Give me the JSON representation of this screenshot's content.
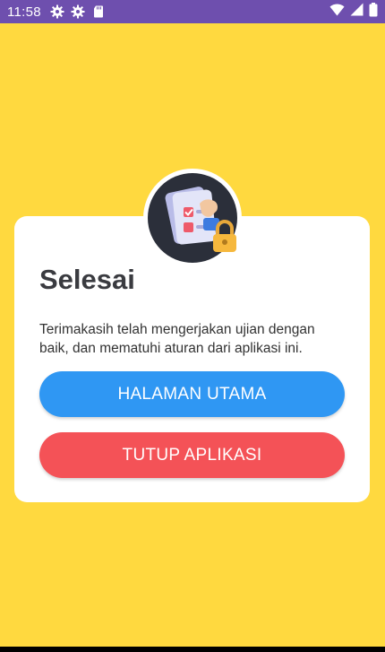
{
  "status_bar": {
    "time": "11:58",
    "left_icons": [
      "gear-icon",
      "gear-icon",
      "sd-card-icon"
    ],
    "right_icons": [
      "wifi-icon",
      "signal-icon",
      "battery-icon"
    ],
    "background": "#6E4FAE"
  },
  "screen": {
    "background": "#FFD93F"
  },
  "dialog": {
    "illustration": "exam-lock-illustration",
    "title": "Selesai",
    "message": "Terimakasih telah mengerjakan ujian dengan baik, dan mematuhi aturan dari aplikasi ini.",
    "primary_button": {
      "label": "HALAMAN UTAMA",
      "color": "#2F97F3"
    },
    "secondary_button": {
      "label": "TUTUP APLIKASI",
      "color": "#F45257"
    }
  }
}
